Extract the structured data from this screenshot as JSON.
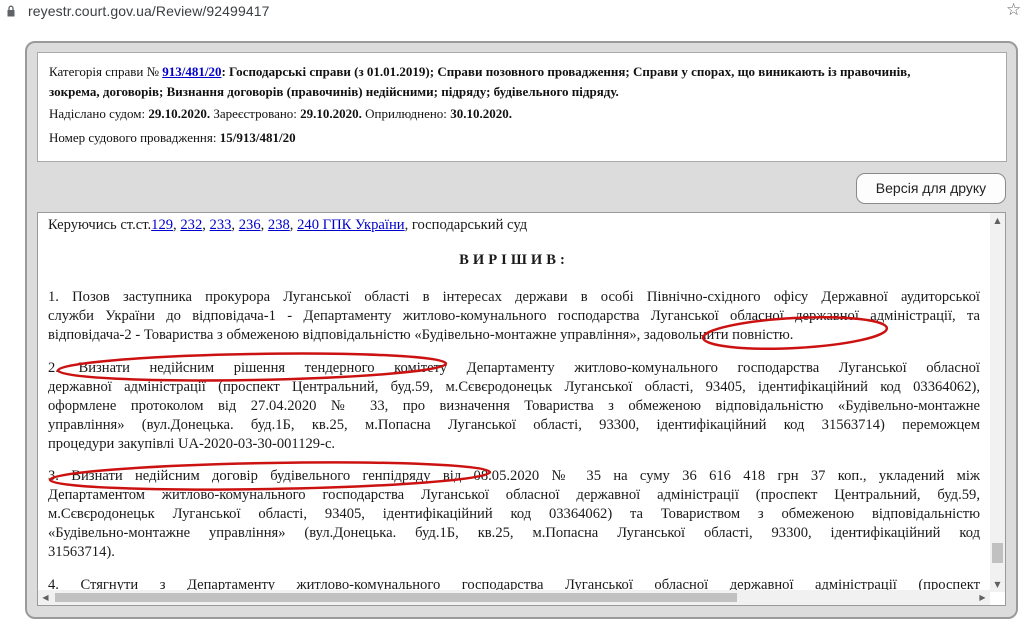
{
  "browser": {
    "url": "reyestr.court.gov.ua/Review/92499417"
  },
  "info": {
    "line1_prefix": "Категорія справи №",
    "case_link": "913/481/20",
    "line1_rest": ": Господарські справи (з 01.01.2019); Справи позовного провадження; Справи у спорах, що виникають із правочинів,",
    "line2": "зокрема, договорів; Визнання договорів (правочинів) недійсними; підряду; будівельного підряду.",
    "sent_label": "Надіслано судом:",
    "sent_date": "29.10.2020.",
    "registered_label": "Зареєстровано:",
    "registered_date": "29.10.2020.",
    "published_label": "Оприлюднено:",
    "published_date": "30.10.2020.",
    "proceeding_label": "Номер судового провадження:",
    "proceeding_number": "15/913/481/20"
  },
  "print_button": "Версія для друку",
  "document": {
    "intro_prefix": "Керуючись ст.ст.",
    "articles": [
      "129",
      "232",
      "233",
      "236",
      "238",
      "240 ГПК України"
    ],
    "intro_suffix": ", господарський суд",
    "heading": "ВИРІШИВ:",
    "p1": [
      "1. Позов заступника прокурора Луганської області в інтересах держави в особі Північно-східного офісу Державної аудиторської",
      "служби України до відповідача-1 - Департаменту житлово-комунального господарства Луганської обласної державної адміністрації, та",
      "відповідача-2 - Товариства з обмеженою відповідальністю «Будівельно-монтажне управління», задовольнити повністю."
    ],
    "p2": [
      "2. Визнати недійсним рішення тендерного комітету Департаменту житлово-комунального господарства Луганської обласної",
      "державної адміністрації (проспект Центральний, буд.59, м.Сєвєродонецьк Луганської області, 93405, ідентифікаційний код 03364062),",
      "оформлене протоколом від 27.04.2020 № 33, про визначення Товариства з обмеженою відповідальністю «Будівельно-монтажне",
      "управління» (вул.Донецька. буд.1Б, кв.25, м.Попасна Луганської області, 93300, ідентифікаційний код 31563714) переможцем",
      "процедури закупівлі UA-2020-03-30-001129-с."
    ],
    "p3": [
      "3. Визнати недійсним договір будівельного генпідряду від 08.05.2020 № 35 на суму 36 616 418 грн 37 коп., укладений між",
      "Департаментом житлово-комунального господарства Луганської обласної державної адміністрації (проспект Центральний, буд.59,",
      "м.Сєвєродонецьк Луганської області, 93405, ідентифікаційний код 03364062) та Товариством з обмеженою відповідальністю",
      "«Будівельно-монтажне управління» (вул.Донецька. буд.1Б, кв.25, м.Попасна Луганської області, 93300, ідентифікаційний код",
      "31563714)."
    ],
    "p4": [
      "4. Стягнути з Департаменту житлово-комунального господарства Луганської обласної державної адміністрації (проспект"
    ]
  },
  "colors": {
    "annotation": "#cc1111",
    "link": "#0000cc",
    "frame": "#dcdcdc"
  }
}
